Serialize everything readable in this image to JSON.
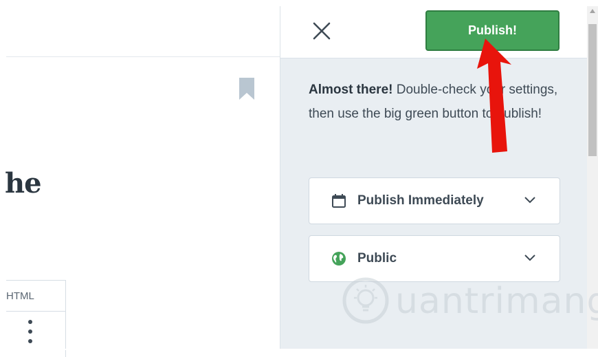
{
  "editor": {
    "title_fragment": "he",
    "html_tab_label": "HTML"
  },
  "publish_panel": {
    "publish_button_label": "Publish!",
    "intro_bold": "Almost there!",
    "intro_text": " Double-check your settings, then use the big green button to publish!",
    "schedule_select": {
      "label": "Publish Immediately",
      "icon": "calendar-icon"
    },
    "visibility_select": {
      "label": "Public",
      "icon": "globe-icon"
    }
  },
  "colors": {
    "publish_green": "#45a35a",
    "panel_bg": "#e9eef2",
    "arrow_red": "#e8140c"
  },
  "watermark": {
    "text": "uantrimang"
  }
}
